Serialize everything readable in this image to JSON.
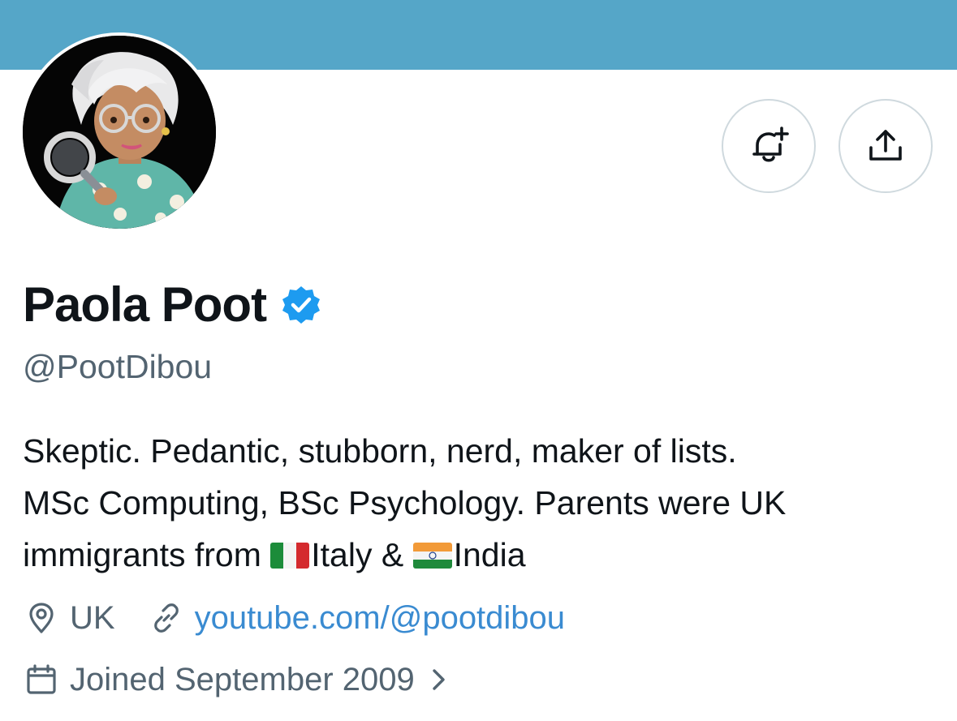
{
  "profile": {
    "display_name": "Paola Poot",
    "handle": "@PootDibou",
    "verified": true,
    "bio_lines": [
      "Skeptic. Pedantic, stubborn, nerd, maker of lists.",
      "MSc Computing, BSc Psychology. Parents were UK"
    ],
    "bio_line3": {
      "before": "immigrants from ",
      "country1": "Italy &",
      "country2": "India"
    },
    "location": "UK",
    "website": "youtube.com/@pootdibou",
    "joined": "Joined September 2009"
  },
  "actions": {
    "notify_icon": "bell-plus-icon",
    "share_icon": "share-icon"
  },
  "icons": {
    "location": "location-pin-icon",
    "link": "link-icon",
    "calendar": "calendar-icon",
    "chevron": "chevron-right-icon",
    "verified": "verified-badge-icon"
  },
  "colors": {
    "banner": "#55a6c8",
    "verified_blue": "#1d9bf0",
    "link_blue": "#3a8bd1",
    "secondary_text": "#536471",
    "primary_text": "#0f1419",
    "border": "#cfd9de"
  }
}
